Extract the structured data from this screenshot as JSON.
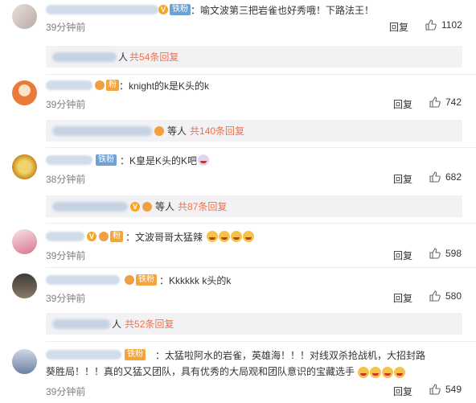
{
  "comments": [
    {
      "text": "：喻文波第三把岩雀也好秀哦！下路法王！",
      "badge": "铁粉",
      "time": "39分钟前",
      "reply": "回复",
      "likes": "1102",
      "sub": {
        "who": "人",
        "count": "共54条回复"
      }
    },
    {
      "text": "：knight的k是K头的k",
      "badge": "",
      "time": "39分钟前",
      "reply": "回复",
      "likes": "742",
      "sub": {
        "who": "等人",
        "count": "共140条回复"
      }
    },
    {
      "text": "：K皇是K头的K吧",
      "badge": "铁粉",
      "time": "38分钟前",
      "reply": "回复",
      "likes": "682",
      "sub": {
        "who": "等人",
        "count": "共87条回复"
      }
    },
    {
      "text": "：文波哥哥太猛辣",
      "badge": "",
      "time": "39分钟前",
      "reply": "回复",
      "likes": "598"
    },
    {
      "text": "：Kkkkkk  k头的k",
      "badge": "",
      "time": "39分钟前",
      "reply": "回复",
      "likes": "580",
      "sub": {
        "who": "人",
        "count": "共52条回复"
      }
    },
    {
      "text": "：太猛啦阿水的岩雀，英雄海！！！对线双杀抢战机，大招封路葵胜局！！！真的又猛又团队，具有优秀的大局观和团队意识的宝藏选手",
      "badge": "",
      "time": "39分钟前",
      "reply": "回复",
      "likes": "549"
    }
  ],
  "colors": {
    "accent": "#eb7350",
    "fan_badge": "#6ea1d6",
    "gold_badge": "#f3a53b"
  }
}
